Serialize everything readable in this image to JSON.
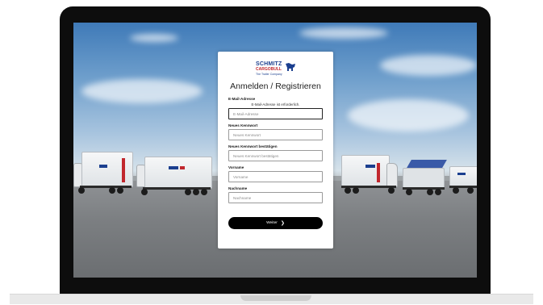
{
  "brand": {
    "name_line1": "SCHMITZ",
    "name_line2": "CARGOBULL",
    "tagline": "The Trailer Company",
    "primary": "#1b3f8f",
    "accent": "#c1272d"
  },
  "form": {
    "title": "Anmelden / Registrieren",
    "email": {
      "label": "E-Mail-Adresse",
      "error": "E-Mail-Adresse ist erforderlich.",
      "placeholder": "E-Mail-Adresse",
      "value": ""
    },
    "new_password": {
      "label": "Neues Kennwort",
      "placeholder": "Neues Kennwort",
      "value": ""
    },
    "confirm_password": {
      "label": "Neues Kennwort bestätigen",
      "placeholder": "Neues Kennwort bestätigen",
      "value": ""
    },
    "first_name": {
      "label": "Vorname",
      "placeholder": "Vorname",
      "value": ""
    },
    "last_name": {
      "label": "Nachname",
      "placeholder": "Nachname",
      "value": ""
    },
    "submit": {
      "label": "Weiter",
      "icon": "chevron-right-icon"
    }
  }
}
